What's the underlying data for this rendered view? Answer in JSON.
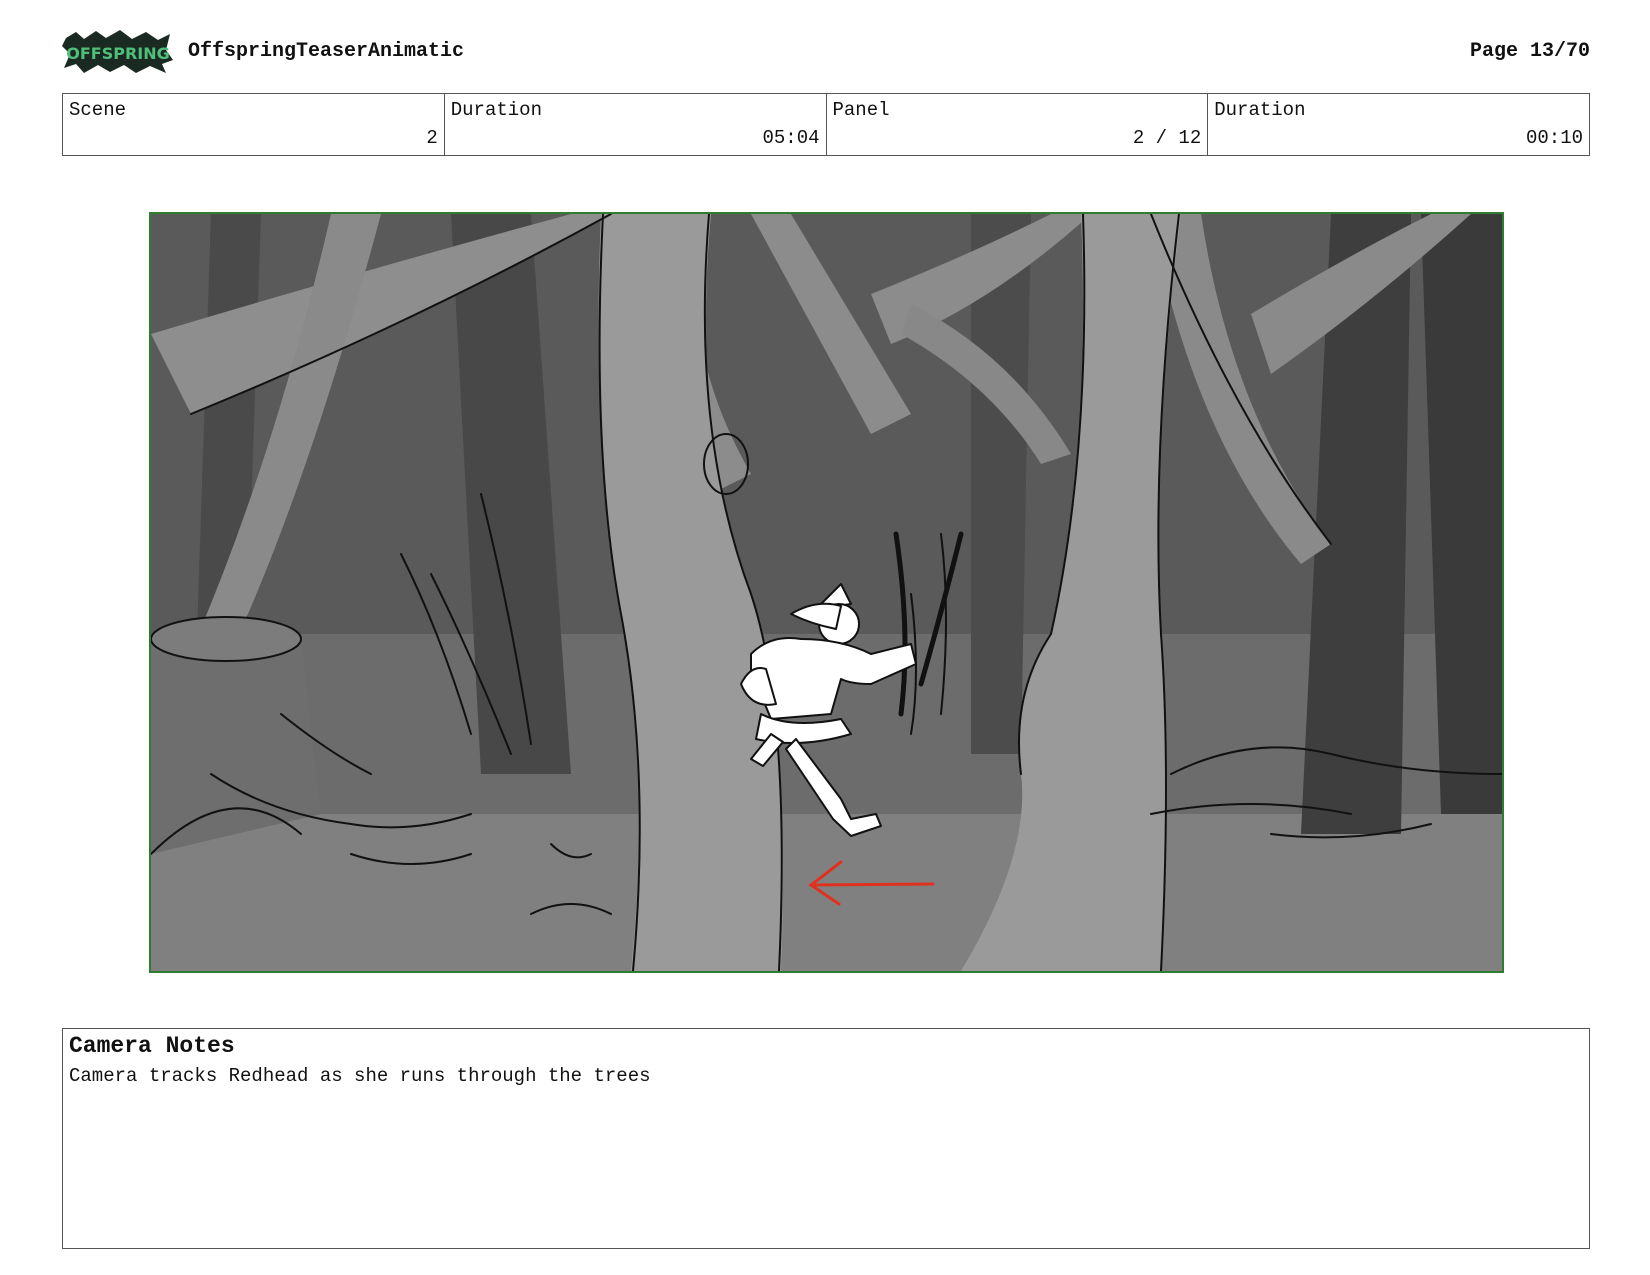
{
  "header": {
    "logo_text": "OFFSPRING",
    "title": "OffspringTeaserAnimatic",
    "page": "Page 13/70"
  },
  "info": {
    "scene_label": "Scene",
    "scene_value": "2",
    "scene_duration_label": "Duration",
    "scene_duration_value": "05:04",
    "panel_label": "Panel",
    "panel_value": "2 / 12",
    "panel_duration_label": "Duration",
    "panel_duration_value": "00:10"
  },
  "notes": {
    "heading": "Camera Notes",
    "text": "Camera tracks Redhead as she runs through the trees"
  },
  "colors": {
    "panel_border": "#2f7d2f",
    "arrow": "#e0301e"
  }
}
